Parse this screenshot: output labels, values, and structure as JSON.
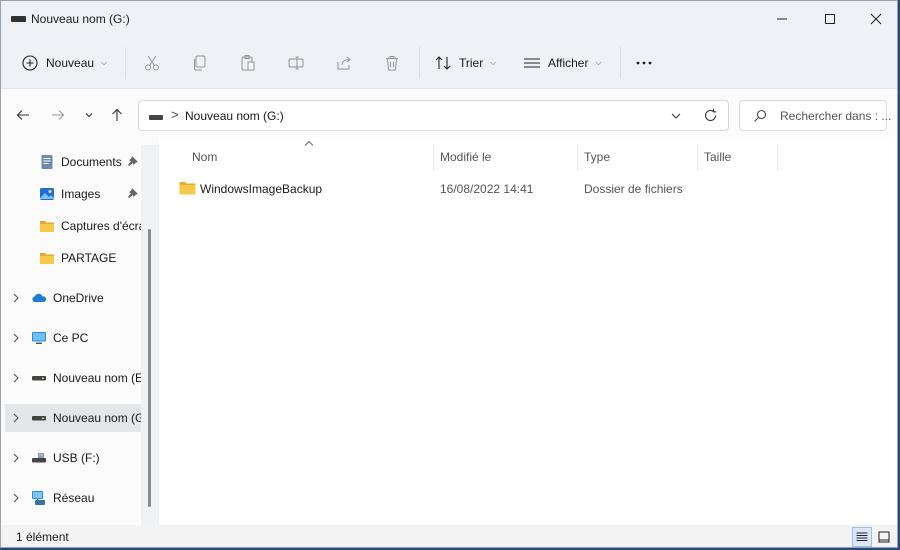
{
  "window": {
    "title": "Nouveau nom (G:)"
  },
  "commands": {
    "new_label": "Nouveau",
    "sort_label": "Trier",
    "view_label": "Afficher",
    "more_label": "•••"
  },
  "address": {
    "separator": ">",
    "path": "Nouveau nom (G:)",
    "search_placeholder": "Rechercher dans : ..."
  },
  "sidebar": {
    "items": [
      {
        "label": "Documents",
        "icon": "documents-icon",
        "pinned": true
      },
      {
        "label": "Images",
        "icon": "images-icon",
        "pinned": true
      },
      {
        "label": "Captures d'écra",
        "icon": "folder-icon"
      },
      {
        "label": "PARTAGE",
        "icon": "folder-icon"
      },
      {
        "label": "OneDrive",
        "icon": "onedrive-icon",
        "expandable": true
      },
      {
        "label": "Ce PC",
        "icon": "pc-icon",
        "expandable": true
      },
      {
        "label": "Nouveau nom (E",
        "icon": "drive-icon",
        "expandable": true
      },
      {
        "label": "Nouveau nom (G",
        "icon": "drive-icon",
        "expandable": true,
        "selected": true
      },
      {
        "label": "USB (F:)",
        "icon": "usb-drive-icon",
        "expandable": true
      },
      {
        "label": "Réseau",
        "icon": "network-icon",
        "expandable": true
      }
    ]
  },
  "columns": {
    "name": "Nom",
    "modified": "Modifié le",
    "type": "Type",
    "size": "Taille",
    "sorted_by": "name"
  },
  "files": [
    {
      "name": "WindowsImageBackup",
      "modified": "16/08/2022 14:41",
      "type": "Dossier de fichiers",
      "size": ""
    }
  ],
  "status": {
    "text": "1 élément"
  },
  "colors": {
    "folder": "#f7c84a",
    "accent": "#0067c0",
    "selected_bg": "#e4e6ea"
  }
}
